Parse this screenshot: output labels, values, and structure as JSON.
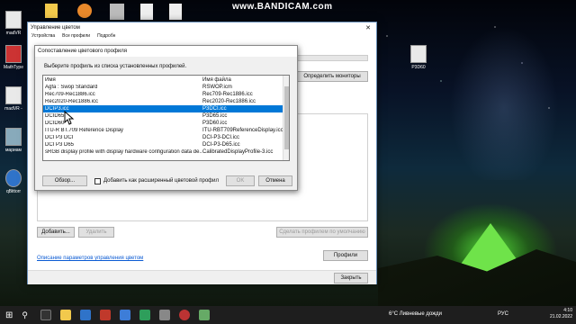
{
  "watermark": "www.BANDICAM.com",
  "desktop": {
    "icons": [
      {
        "name": "madVR"
      },
      {
        "name": "MathType"
      },
      {
        "name": "madVR -"
      },
      {
        "name": "мариам"
      },
      {
        "name": "qBittorr"
      },
      {
        "name": "P3D60"
      }
    ]
  },
  "main_window": {
    "title": "Управление цветом",
    "tabs": [
      "Устройства",
      "Все профили",
      "Подробн"
    ],
    "identify_button": "Определить мониторы",
    "add_button": "Добавить...",
    "remove_button": "Удалить",
    "default_button": "Сделать профилем по умолчанию",
    "link": "Описание параметров управления цветом",
    "profiles_button": "Профили",
    "close_button": "Закрыть",
    "close_x": "✕"
  },
  "dialog": {
    "title": "Сопоставление цветового профиля",
    "instruction": "Выберите профиль из списка установленных профилей.",
    "col_name": "Имя",
    "col_file": "Имя файла",
    "rows": [
      {
        "name": "Agfa : Swop Standard",
        "file": "RSWOP.icm"
      },
      {
        "name": "Rec709-Rec1886.icc",
        "file": "Rec709-Rec1886.icc"
      },
      {
        "name": "Rec2020-Rec1886.icc",
        "file": "Rec2020-Rec1886.icc"
      },
      {
        "name": "DCIP3.icc",
        "file": "P3DCI.icc"
      },
      {
        "name": "DCID65",
        "file": "P3D65.icc"
      },
      {
        "name": "DCID60",
        "file": "P3D60.icc"
      },
      {
        "name": "ITU-R BT.709 Reference Display",
        "file": "ITU-RBT709ReferenceDisplay.icc"
      },
      {
        "name": "DCI P3 DCI",
        "file": "DCI-P3-DCI.icc"
      },
      {
        "name": "DCI P3 D65",
        "file": "DCI-P3-D65.icc"
      },
      {
        "name": "sRGB display profile with display hardware configuration data de...",
        "file": "CalibratedDisplayProfile-3.icc"
      }
    ],
    "selected_index": 3,
    "browse_button": "Обзор...",
    "checkbox_label": "Добавить как расширенный цветовой профил",
    "ok_button": "OK",
    "cancel_button": "Отмена"
  },
  "taskbar": {
    "weather": "6°C  Ливневые дожди",
    "lang": "РУС",
    "time": "4:10",
    "date": "21.02.2022"
  }
}
